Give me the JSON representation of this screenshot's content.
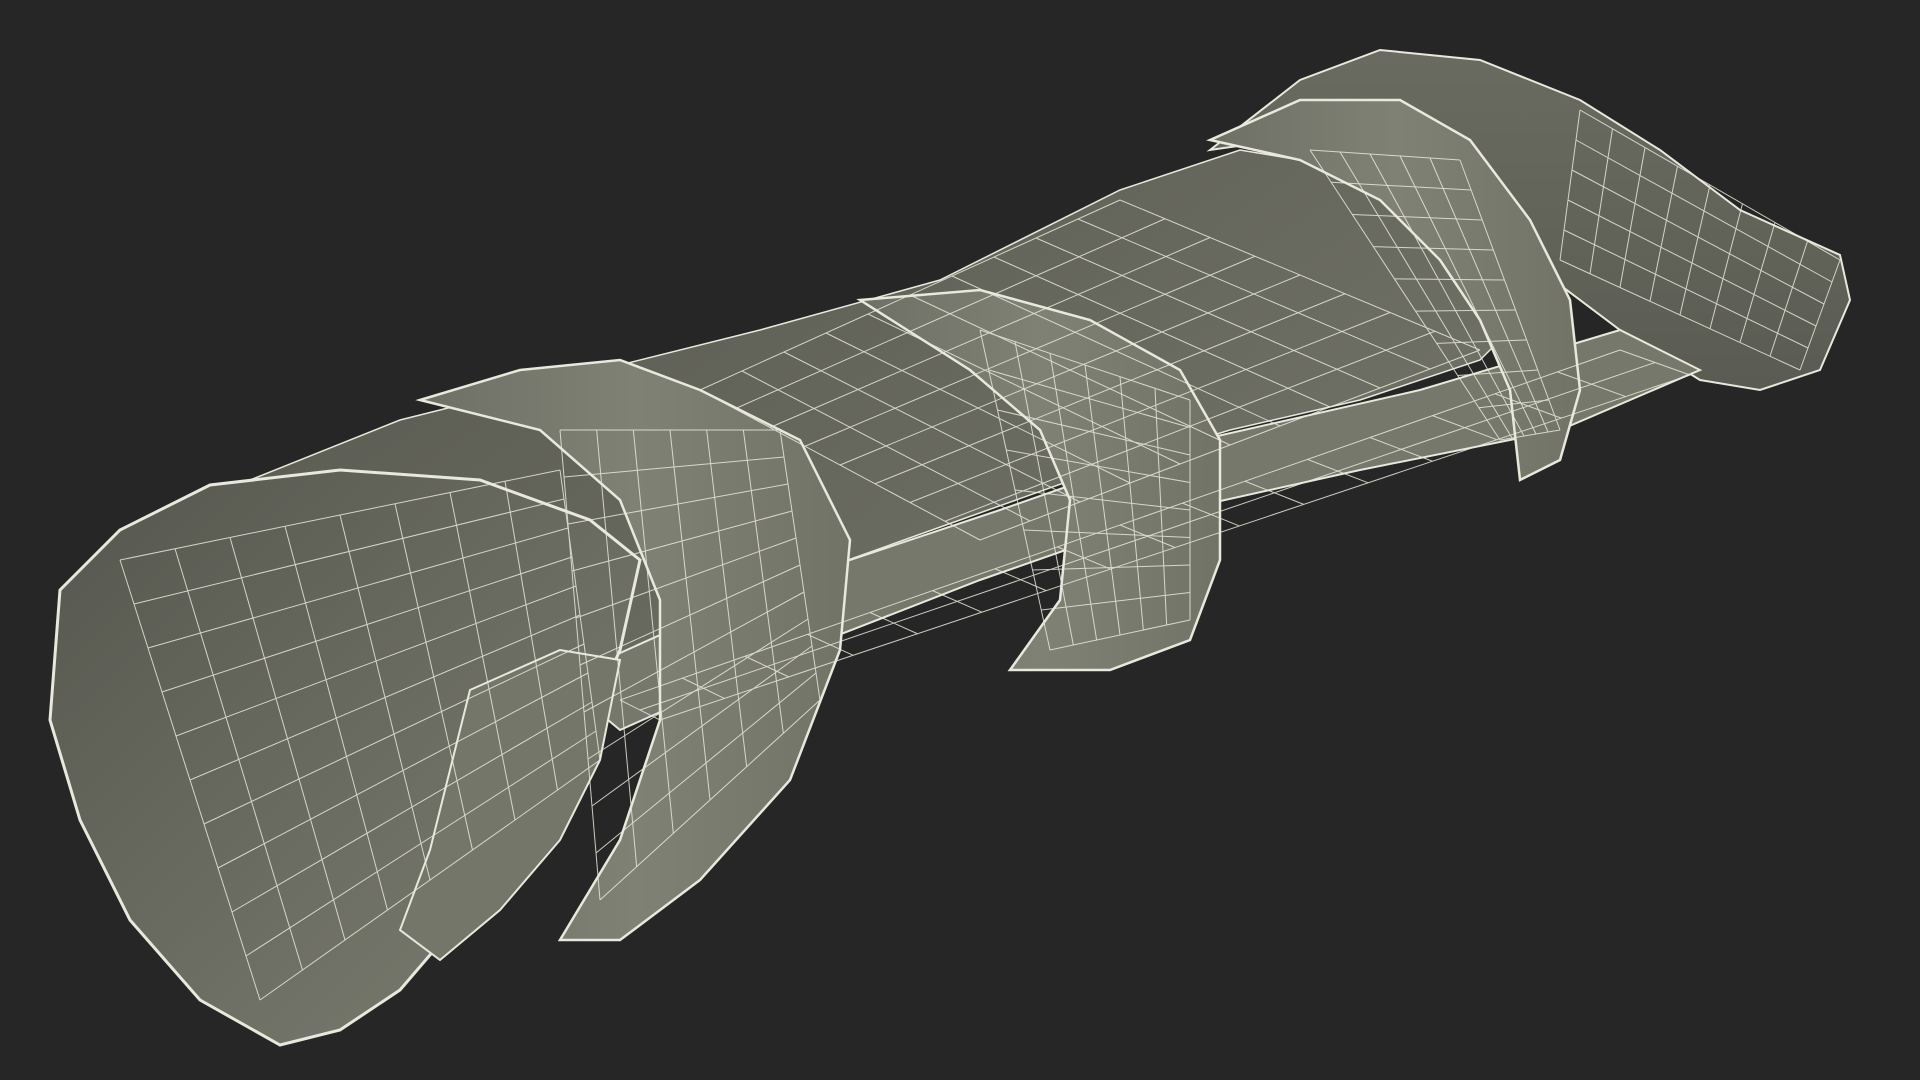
{
  "scene": {
    "background_color": "#262626",
    "model_fill_color": "#7b7c70",
    "model_inner_color": "#5f6056",
    "model_shadow_color": "#4a4b43",
    "wire_color": "#e8e8dc"
  }
}
